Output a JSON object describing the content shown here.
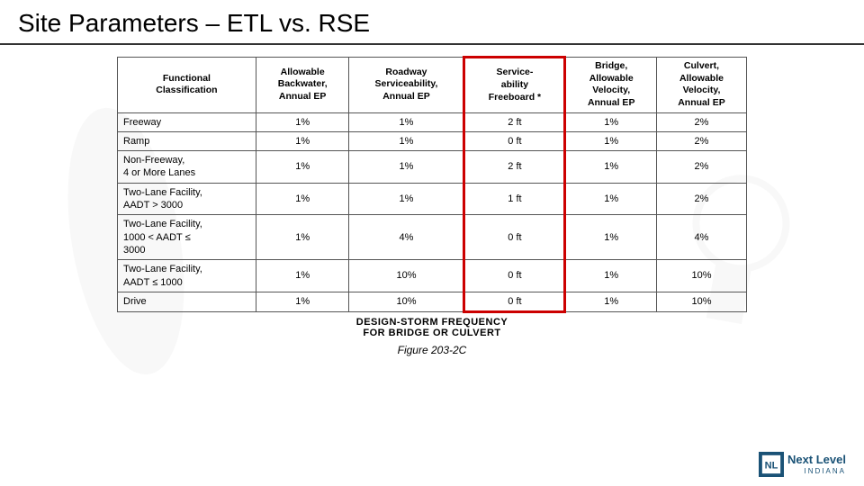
{
  "page": {
    "title": "Site Parameters – ETL vs. RSE"
  },
  "table": {
    "headers": [
      "Functional Classification",
      "Allowable Backwater, Annual EP",
      "Roadway Serviceability, Annual EP",
      "Service-ability Freeboard *",
      "Bridge, Allowable Velocity, Annual EP",
      "Culvert, Allowable Velocity, Annual EP"
    ],
    "rows": [
      [
        "Freeway",
        "1%",
        "1%",
        "2 ft",
        "1%",
        "2%"
      ],
      [
        "Ramp",
        "1%",
        "1%",
        "0 ft",
        "1%",
        "2%"
      ],
      [
        "Non-Freeway, 4 or More Lanes",
        "1%",
        "1%",
        "2 ft",
        "1%",
        "2%"
      ],
      [
        "Two-Lane Facility, AADT > 3000",
        "1%",
        "1%",
        "1 ft",
        "1%",
        "2%"
      ],
      [
        "Two-Lane Facility, 1000 < AADT ≤ 3000",
        "1%",
        "4%",
        "0 ft",
        "1%",
        "4%"
      ],
      [
        "Two-Lane Facility, AADT ≤ 1000",
        "1%",
        "10%",
        "0 ft",
        "1%",
        "10%"
      ],
      [
        "Drive",
        "1%",
        "10%",
        "0 ft",
        "1%",
        "10%"
      ]
    ]
  },
  "figure": {
    "design_storm_line1": "DESIGN-STORM FREQUENCY",
    "design_storm_line2": "FOR BRIDGE OR CULVERT",
    "label": "Figure 203-2C"
  },
  "logo": {
    "icon": "NL",
    "name": "Next Level",
    "state": "INDIANA"
  }
}
